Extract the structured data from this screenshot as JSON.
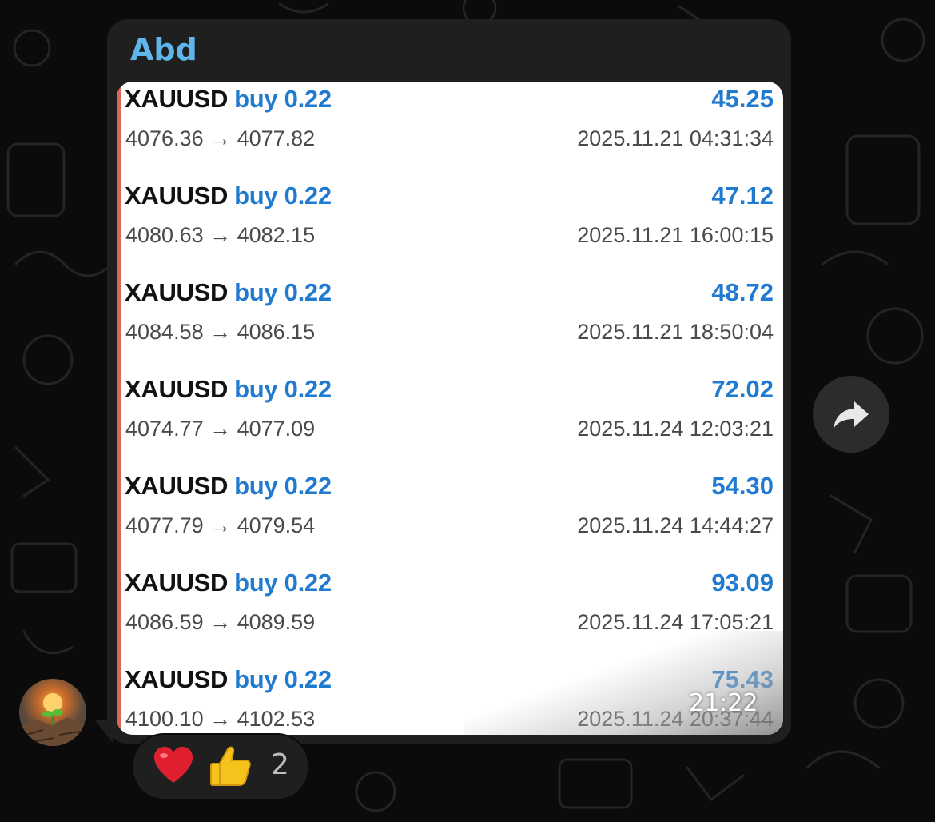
{
  "chat": {
    "sender_name": "Abd",
    "message_time": "21:22",
    "reactions": {
      "emojis": [
        "red-heart",
        "thumbs-up"
      ],
      "count": "2"
    }
  },
  "colors": {
    "profit_blue": "#1f7ad0",
    "accent_bar": "#d9675a",
    "sender_name": "#5fb6ea"
  },
  "trades": [
    {
      "symbol": "XAUUSD",
      "side": "buy 0.22",
      "profit": "45.25",
      "prices": "4076.36 → 4077.82",
      "time": "2025.11.21 04:31:34"
    },
    {
      "symbol": "XAUUSD",
      "side": "buy 0.22",
      "profit": "47.12",
      "prices": "4080.63 → 4082.15",
      "time": "2025.11.21 16:00:15"
    },
    {
      "symbol": "XAUUSD",
      "side": "buy 0.22",
      "profit": "48.72",
      "prices": "4084.58 → 4086.15",
      "time": "2025.11.21 18:50:04"
    },
    {
      "symbol": "XAUUSD",
      "side": "buy 0.22",
      "profit": "72.02",
      "prices": "4074.77 → 4077.09",
      "time": "2025.11.24 12:03:21"
    },
    {
      "symbol": "XAUUSD",
      "side": "buy 0.22",
      "profit": "54.30",
      "prices": "4077.79 → 4079.54",
      "time": "2025.11.24 14:44:27"
    },
    {
      "symbol": "XAUUSD",
      "side": "buy 0.22",
      "profit": "93.09",
      "prices": "4086.59 → 4089.59",
      "time": "2025.11.24 17:05:21"
    },
    {
      "symbol": "XAUUSD",
      "side": "buy 0.22",
      "profit": "75.43",
      "prices": "4100.10 → 4102.53",
      "time": "2025.11.24 20:37:44"
    }
  ]
}
